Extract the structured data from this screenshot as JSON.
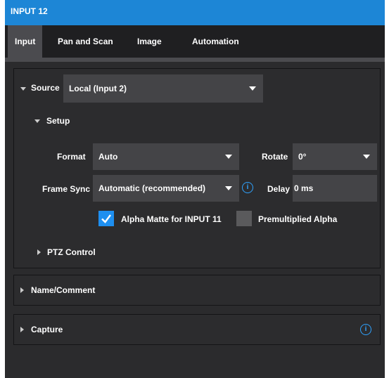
{
  "window": {
    "title": "INPUT 12"
  },
  "tabs": [
    {
      "label": "Input",
      "active": true
    },
    {
      "label": "Pan and Scan",
      "active": false
    },
    {
      "label": "Image",
      "active": false
    },
    {
      "label": "Automation",
      "active": false
    }
  ],
  "source": {
    "label": "Source",
    "value": "Local (Input 2)"
  },
  "setup": {
    "label": "Setup",
    "format": {
      "label": "Format",
      "value": "Auto"
    },
    "rotate": {
      "label": "Rotate",
      "value": "0°"
    },
    "frame_sync": {
      "label": "Frame Sync",
      "value": "Automatic (recommended)"
    },
    "delay": {
      "label": "Delay",
      "value": "0 ms"
    },
    "alpha_matte": {
      "label": "Alpha Matte for INPUT 11",
      "checked": true
    },
    "premultiplied": {
      "label": "Premultiplied Alpha",
      "checked": false
    }
  },
  "ptz": {
    "label": "PTZ Control"
  },
  "name_comment": {
    "label": "Name/Comment"
  },
  "capture": {
    "label": "Capture"
  },
  "colors": {
    "accent": "#1d86d6",
    "panel": "#2c2c2e",
    "field": "#444447",
    "info": "#2fa3ff"
  }
}
